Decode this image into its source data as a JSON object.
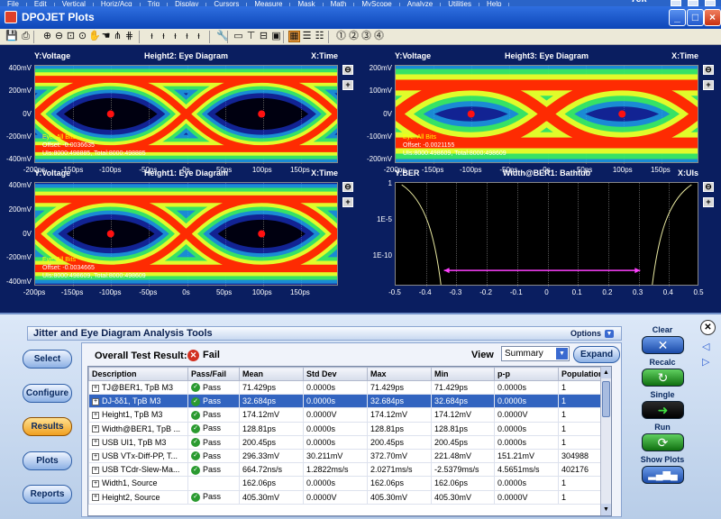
{
  "menubar": {
    "items": [
      "File",
      "Edit",
      "Vertical",
      "Horiz/Acq",
      "Trig",
      "Display",
      "Cursors",
      "Measure",
      "Mask",
      "Math",
      "MyScope",
      "Analyze",
      "Utilities",
      "Help"
    ],
    "brand": "Tek"
  },
  "window": {
    "title": "DPOJET Plots",
    "min": "_",
    "max": "□",
    "close": "×"
  },
  "toolbar": {
    "icons": [
      "save-icon",
      "print-icon",
      "zoom-in-icon",
      "zoom-out-icon",
      "zoom-fit-icon",
      "pan-icon",
      "grab-icon",
      "hand-icon",
      "cursor-a-icon",
      "cursor-b-icon",
      "marker-1-icon",
      "marker-2-icon",
      "marker-3-icon",
      "marker-4-icon",
      "marker-5-icon",
      "wrench-icon",
      "layout-1-icon",
      "layout-2-icon",
      "layout-3-icon",
      "layout-4-icon",
      "grid-2x2-icon",
      "grid-rows-icon",
      "grid-list-icon",
      "plot-1-icon",
      "plot-2-icon",
      "plot-3-icon",
      "plot-4-icon"
    ],
    "plot_numbers": [
      "1",
      "2",
      "3",
      "4"
    ]
  },
  "plots": [
    {
      "id": "p1",
      "y_label": "Y:Voltage",
      "title": "Height2: Eye Diagram",
      "x_label": "X:Time",
      "yticks": [
        "400mV",
        "200mV",
        "0V",
        "-200mV",
        "-400mV"
      ],
      "xticks": [
        "-200ps",
        "-150ps",
        "-100ps",
        "-50ps",
        "0s",
        "50ps",
        "100ps",
        "150ps"
      ],
      "info": [
        "Eye: All Bits",
        "Offset: -0.0036635",
        "UIs:8000:498885, Total:8000:498885"
      ],
      "side_buttons": [
        "⊖",
        "+"
      ]
    },
    {
      "id": "p2",
      "y_label": "Y:Voltage",
      "title": "Height3: Eye Diagram",
      "x_label": "X:Time",
      "yticks": [
        "200mV",
        "100mV",
        "0V",
        "-100mV",
        "-200mV"
      ],
      "xticks": [
        "-200ps",
        "-150ps",
        "-100ps",
        "-50ps",
        "0s",
        "50ps",
        "100ps",
        "150ps"
      ],
      "info": [
        "Eye: All Bits",
        "Offset: -0.0021155",
        "UIs:8000:498609, Total:8000:498609"
      ],
      "side_buttons": [
        "⊖",
        "+"
      ]
    },
    {
      "id": "p3",
      "y_label": "Y:Voltage",
      "title": "Height1: Eye Diagram",
      "x_label": "X:Time",
      "yticks": [
        "400mV",
        "200mV",
        "0V",
        "-200mV",
        "-400mV"
      ],
      "xticks": [
        "-200ps",
        "-150ps",
        "-100ps",
        "-50ps",
        "0s",
        "50ps",
        "100ps",
        "150ps"
      ],
      "info": [
        "Eye: All Bits",
        "Offset: -0.0034665",
        "UIs:8000:498609, Total:8000:498609"
      ],
      "side_buttons": [
        "⊖",
        "+"
      ]
    },
    {
      "id": "p4",
      "y_label": "Y:BER",
      "title": "Width@BER1: Bathtub",
      "x_label": "X:UIs",
      "yticks": [
        "1",
        "1E-5",
        "1E-10"
      ],
      "xticks": [
        "-0.5",
        "-0.4",
        "-0.3",
        "-0.2",
        "-0.1",
        "0",
        "0.1",
        "0.2",
        "0.3",
        "0.4",
        "0.5"
      ],
      "info": [],
      "side_buttons": [
        "⊖",
        "+"
      ]
    }
  ],
  "panel": {
    "title": "Jitter and Eye Diagram Analysis Tools",
    "options_label": "Options",
    "nav": [
      "Select",
      "Configure",
      "Results",
      "Plots",
      "Reports"
    ],
    "active_nav": "Results",
    "overall_label": "Overall Test Result:",
    "overall_status": "Fail",
    "view_label": "View",
    "view_value": "Summary",
    "expand_label": "Expand",
    "columns": [
      "Description",
      "Pass/Fail",
      "Mean",
      "Std Dev",
      "Max",
      "Min",
      "p-p",
      "Population"
    ],
    "rows": [
      {
        "desc": "TJ@BER1, TpB M3",
        "pf": "Pass",
        "mean": "71.429ps",
        "std": "0.0000s",
        "max": "71.429ps",
        "min": "71.429ps",
        "pp": "0.0000s",
        "pop": "1"
      },
      {
        "desc": "DJ-δδ1, TpB M3",
        "pf": "Pass",
        "mean": "32.684ps",
        "std": "0.0000s",
        "max": "32.684ps",
        "min": "32.684ps",
        "pp": "0.0000s",
        "pop": "1"
      },
      {
        "desc": "Height1, TpB M3",
        "pf": "Pass",
        "mean": "174.12mV",
        "std": "0.0000V",
        "max": "174.12mV",
        "min": "174.12mV",
        "pp": "0.0000V",
        "pop": "1"
      },
      {
        "desc": "Width@BER1, TpB ...",
        "pf": "Pass",
        "mean": "128.81ps",
        "std": "0.0000s",
        "max": "128.81ps",
        "min": "128.81ps",
        "pp": "0.0000s",
        "pop": "1"
      },
      {
        "desc": "USB UI1, TpB M3",
        "pf": "Pass",
        "mean": "200.45ps",
        "std": "0.0000s",
        "max": "200.45ps",
        "min": "200.45ps",
        "pp": "0.0000s",
        "pop": "1"
      },
      {
        "desc": "USB VTx-Diff-PP, T...",
        "pf": "Pass",
        "mean": "296.33mV",
        "std": "30.211mV",
        "max": "372.70mV",
        "min": "221.48mV",
        "pp": "151.21mV",
        "pop": "304988"
      },
      {
        "desc": "USB TCdr-Slew-Ma...",
        "pf": "Pass",
        "mean": "664.72ns/s",
        "std": "1.2822ms/s",
        "max": "2.0271ms/s",
        "min": "-2.5379ms/s",
        "pp": "4.5651ms/s",
        "pop": "402176"
      },
      {
        "desc": "Width1, Source",
        "pf": "",
        "mean": "162.06ps",
        "std": "0.0000s",
        "max": "162.06ps",
        "min": "162.06ps",
        "pp": "0.0000s",
        "pop": "1"
      },
      {
        "desc": "Height2, Source",
        "pf": "Pass",
        "mean": "405.30mV",
        "std": "0.0000V",
        "max": "405.30mV",
        "min": "405.30mV",
        "pp": "0.0000V",
        "pop": "1"
      }
    ],
    "selected_row": 1,
    "right": {
      "clear": "Clear",
      "recalc": "Recalc",
      "single": "Single",
      "run": "Run",
      "show_plots": "Show Plots"
    }
  }
}
